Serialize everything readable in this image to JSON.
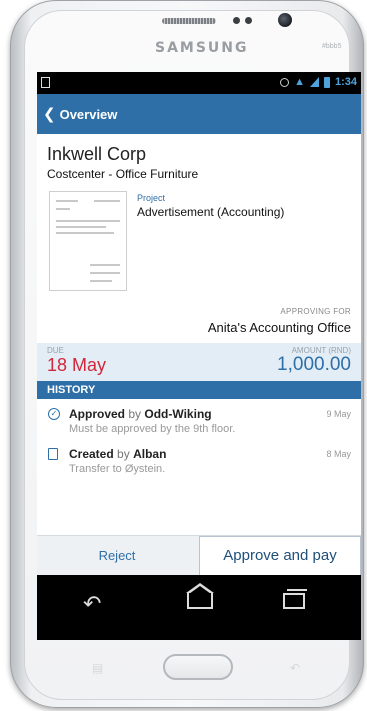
{
  "device": {
    "brand": "SAMSUNG",
    "serial": "#bbb5"
  },
  "status_bar": {
    "time": "1:34"
  },
  "app_bar": {
    "back_label": "Overview"
  },
  "invoice": {
    "company": "Inkwell Corp",
    "costcenter": "Costcenter - Office Furniture",
    "project_label": "Project",
    "project_value": "Advertisement (Accounting)",
    "approving_for_label": "APPROVING FOR",
    "approving_for_value": "Anita's Accounting Office",
    "due_label": "DUE",
    "due_value": "18 May",
    "amount_label": "AMOUNT (RND)",
    "amount_value": "1,000.00"
  },
  "history": {
    "title": "HISTORY",
    "items": [
      {
        "action": "Approved",
        "by": "by",
        "person": "Odd-Wiking",
        "note": "Must be approved by the 9th floor.",
        "date": "9 May",
        "icon": "check-circle-icon"
      },
      {
        "action": "Created",
        "by": "by",
        "person": "Alban",
        "note": "Transfer to Øystein.",
        "date": "8 May",
        "icon": "document-icon"
      }
    ]
  },
  "actions": {
    "reject_label": "Reject",
    "approve_label": "Approve and pay"
  },
  "colors": {
    "accent": "#2e6fa8",
    "due": "#d1263b",
    "summary_bg": "#e3edf6"
  }
}
